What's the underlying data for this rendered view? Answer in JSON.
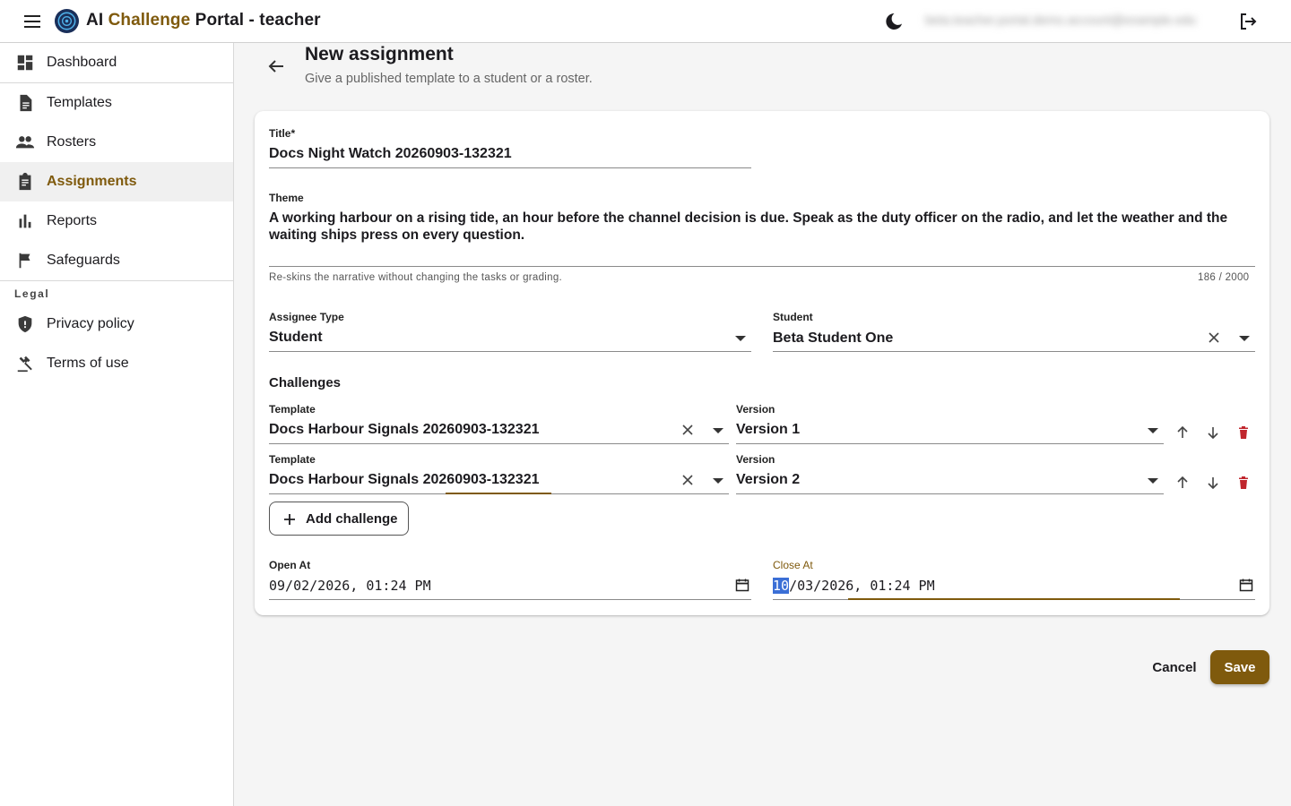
{
  "app": {
    "title_prefix": "AI ",
    "title_accent": "Challenge",
    "title_suffix": " Portal - teacher",
    "user_email": "beta.teacher.portal.demo.account@example.edu",
    "icons": {
      "menu": "menu-icon",
      "logo": "logo-icon",
      "theme": "moon-icon",
      "logout": "logout-icon"
    },
    "accent_color": "#7f5a0d"
  },
  "sidebar": {
    "items": [
      {
        "label": "Dashboard",
        "icon": "dashboard-icon"
      },
      {
        "label": "Templates",
        "icon": "document-icon"
      },
      {
        "label": "Rosters",
        "icon": "people-icon"
      },
      {
        "label": "Assignments",
        "icon": "clipboard-icon",
        "active": true
      },
      {
        "label": "Reports",
        "icon": "bar-chart-icon"
      },
      {
        "label": "Safeguards",
        "icon": "flag-icon"
      }
    ],
    "legal_heading": "Legal",
    "legal_items": [
      {
        "label": "Privacy policy",
        "icon": "shield-icon"
      },
      {
        "label": "Terms of use",
        "icon": "gavel-icon"
      }
    ]
  },
  "page": {
    "title": "New assignment",
    "subtitle": "Give a published template to a student or a roster."
  },
  "form": {
    "title_label": "Title*",
    "title_value": "Docs Night Watch 20260903-132321",
    "theme_label": "Theme",
    "theme_value": "A working harbour on a rising tide, an hour before the channel decision is due. Speak as the duty officer on the radio, and let the weather and the waiting ships press on every question.",
    "theme_helper": "Re-skins the narrative without changing the tasks or grading.",
    "theme_counter": "186 / 2000",
    "assignee_type_label": "Assignee Type",
    "assignee_type_value": "Student",
    "student_label": "Student",
    "student_value": "Beta Student One",
    "challenges_heading": "Challenges",
    "challenges": [
      {
        "template_label": "Template",
        "template_value": "Docs Harbour Signals 20260903-132321",
        "version_label": "Version",
        "version_value": "Version 1"
      },
      {
        "template_label": "Template",
        "template_value": "Docs Harbour Signals 20260903-132321",
        "version_label": "Version",
        "version_value": "Version 2"
      }
    ],
    "add_challenge_label": "Add challenge",
    "open_at_label": "Open At",
    "open_at_value": "09/02/2026, 01:24 PM",
    "close_at_label": "Close At",
    "close_at_month": "10",
    "close_at_rest": "/03/2026, 01:24 PM"
  },
  "actions": {
    "cancel_label": "Cancel",
    "save_label": "Save"
  }
}
